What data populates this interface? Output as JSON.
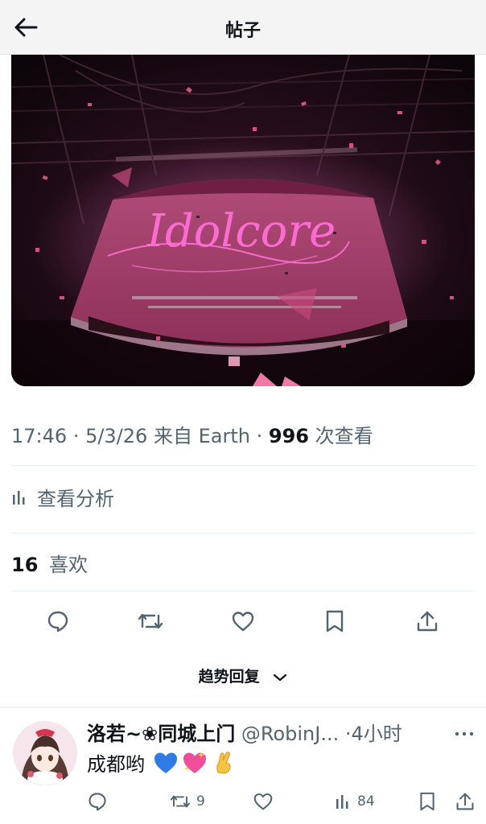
{
  "header": {
    "title": "帖子",
    "back_icon": "arrow-left-icon"
  },
  "media": {
    "alt_text": "Idolcore"
  },
  "meta": {
    "time": "17:46",
    "date": "5/3/26",
    "source_prefix": "来自",
    "source": "Earth",
    "views_count": "996",
    "views_label": "次查看"
  },
  "analytics": {
    "label": "查看分析",
    "icon": "bar-chart-icon"
  },
  "likes": {
    "count": "16",
    "label": "喜欢"
  },
  "actions": [
    "reply-icon",
    "retweet-icon",
    "like-icon",
    "bookmark-icon",
    "share-icon"
  ],
  "trending": {
    "label": "趋势回复",
    "icon": "chevron-down-icon"
  },
  "reply": {
    "name": "洛若~❀同城上门",
    "handle": "@RobinJ...",
    "time": "4小时",
    "text": "成都哟",
    "emojis": [
      "blue-heart-icon",
      "sparkling-heart-icon",
      "crossed-fingers-icon"
    ],
    "retweets": "9",
    "views": "84"
  },
  "colors": {
    "text": "#0f1419",
    "secondary": "#536471",
    "divider": "#e6ecf0",
    "header_bg": "#f4f4f4"
  }
}
